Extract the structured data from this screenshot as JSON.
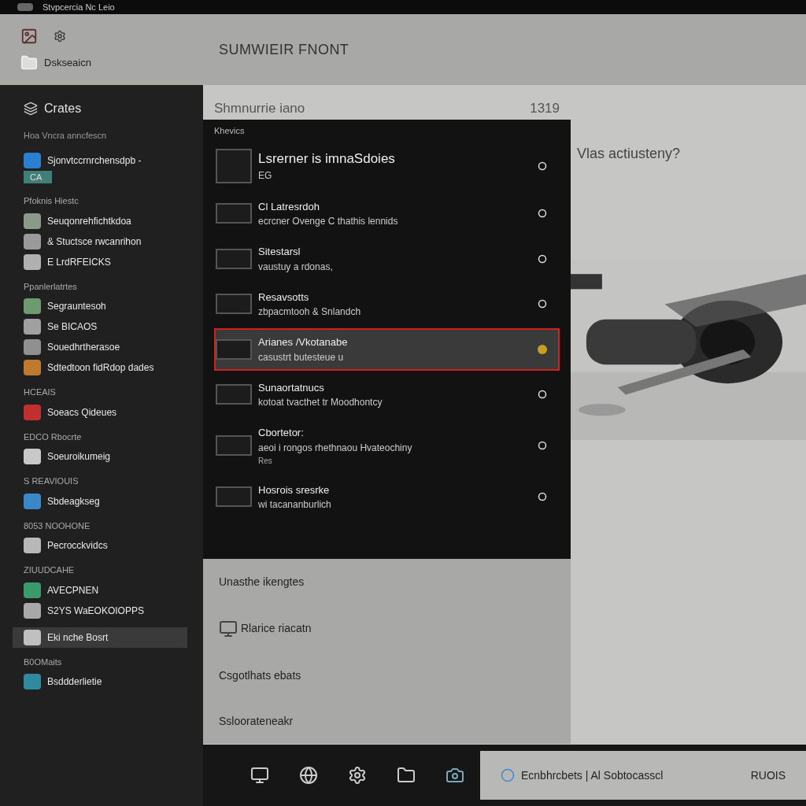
{
  "window": {
    "title": "Stvpcercia Nc Leio"
  },
  "header": {
    "nav_item": "Dskseaicn",
    "title": "SUMWIEIR FNONT"
  },
  "sidebar": {
    "title": "Crates",
    "subtitle": "Hoa Vncra anncfescn",
    "entries": [
      {
        "kind": "item",
        "text": "Sjonvtccrnrchensdpb -",
        "color": "#2a7fd0",
        "badge": "CA",
        "selected": false
      },
      {
        "kind": "label",
        "text": "Pfoknis Hiestc"
      },
      {
        "kind": "item",
        "text": "Seuqonrehfichtkdoa",
        "color": "#8a9a8a",
        "selected": false
      },
      {
        "kind": "item",
        "text": "& Stuctsce rwcanrihon",
        "color": "#9a9a9a",
        "selected": false
      },
      {
        "kind": "item",
        "text": "E LrdRFEICKS",
        "color": "#b0b0b0",
        "selected": false
      },
      {
        "kind": "label",
        "text": "Ppanlerlatrtes"
      },
      {
        "kind": "item",
        "text": "Segrauntesoh",
        "color": "#6f9a6f",
        "selected": false
      },
      {
        "kind": "item",
        "text": "Se BICAOS",
        "color": "#a0a0a0",
        "selected": false
      },
      {
        "kind": "item",
        "text": "Souedhrtherasoe",
        "color": "#909090",
        "selected": false
      },
      {
        "kind": "item",
        "text": "Sdtedtoon fidRdop dades",
        "color": "#c07a30",
        "selected": false
      },
      {
        "kind": "label",
        "text": "HCEAIS"
      },
      {
        "kind": "item",
        "text": "Soeacs Qideues",
        "color": "#c03030",
        "selected": false
      },
      {
        "kind": "label",
        "text": "EDCO Rbocrte"
      },
      {
        "kind": "item",
        "text": "Soeuroikumeig",
        "color": "#c8c8c8",
        "selected": false
      },
      {
        "kind": "label",
        "text": "S REAVIOUIS"
      },
      {
        "kind": "item",
        "text": "Sbdeagkseg",
        "color": "#3a88c8",
        "selected": false
      },
      {
        "kind": "label",
        "text": "8053 NOOHONE"
      },
      {
        "kind": "item",
        "text": "Pecrocckvidcs",
        "color": "#b8b8b8",
        "selected": false
      },
      {
        "kind": "label",
        "text": "ZIUUDCAHE"
      },
      {
        "kind": "item",
        "text": "AVECPNEN",
        "color": "#3a9a6a",
        "selected": false
      },
      {
        "kind": "item",
        "text": "S2YS WaEOKOIOPPS",
        "color": "#a8a8a8",
        "selected": false
      },
      {
        "kind": "item",
        "text": "Eki nche Bosrt",
        "color": "#c0c0c0",
        "selected": true
      },
      {
        "kind": "label",
        "text": "B0OMaits"
      },
      {
        "kind": "item",
        "text": "Bsddderlietie",
        "color": "#2f8aa0",
        "selected": false
      }
    ]
  },
  "strip": {
    "text": "Shmnurrie iano",
    "count": "1319"
  },
  "panel": {
    "heading": "Khevics",
    "rows": [
      {
        "title": "Lsrerner is imnaSdoies",
        "subtitle": "EG",
        "selected": false
      },
      {
        "title": "Cl Latresrdoh",
        "subtitle": "ecrcner Ovenge C thathis lennids",
        "selected": false
      },
      {
        "title": "Sitestarsl",
        "subtitle": "vaustuy a rdonas,",
        "selected": false
      },
      {
        "title": "Resavsotts",
        "subtitle": "zbpacmtooh & Snlandch",
        "selected": false
      },
      {
        "title": "Arianes /Vkotanabe",
        "subtitle": "casustrt butesteue u",
        "selected": true
      },
      {
        "title": "Sunaortatnucs",
        "subtitle": "kotoat tvacthet tr Moodhontcy",
        "selected": false
      },
      {
        "title": "Cbortetor:",
        "subtitle": "aeoi i rongos rhethnaou Hvateochiny",
        "note": "Res",
        "selected": false
      },
      {
        "title": "Hosrois sresrke",
        "subtitle": "wi tacananburlich",
        "selected": false
      }
    ]
  },
  "lower": {
    "items": [
      {
        "kind": "text",
        "text": "Unasthe ikengtes"
      },
      {
        "kind": "device",
        "text": "Rlarice riacatn"
      },
      {
        "kind": "text",
        "text": "Csgotlhats ebats"
      },
      {
        "kind": "text",
        "text": "Ssloorateneakr"
      }
    ]
  },
  "right": {
    "question": "Vlas actiusteny?"
  },
  "taskbar": {
    "tray_text": "Ecnbhrcbets | Al Sobtocasscl",
    "tray_time": "RUOIS"
  }
}
